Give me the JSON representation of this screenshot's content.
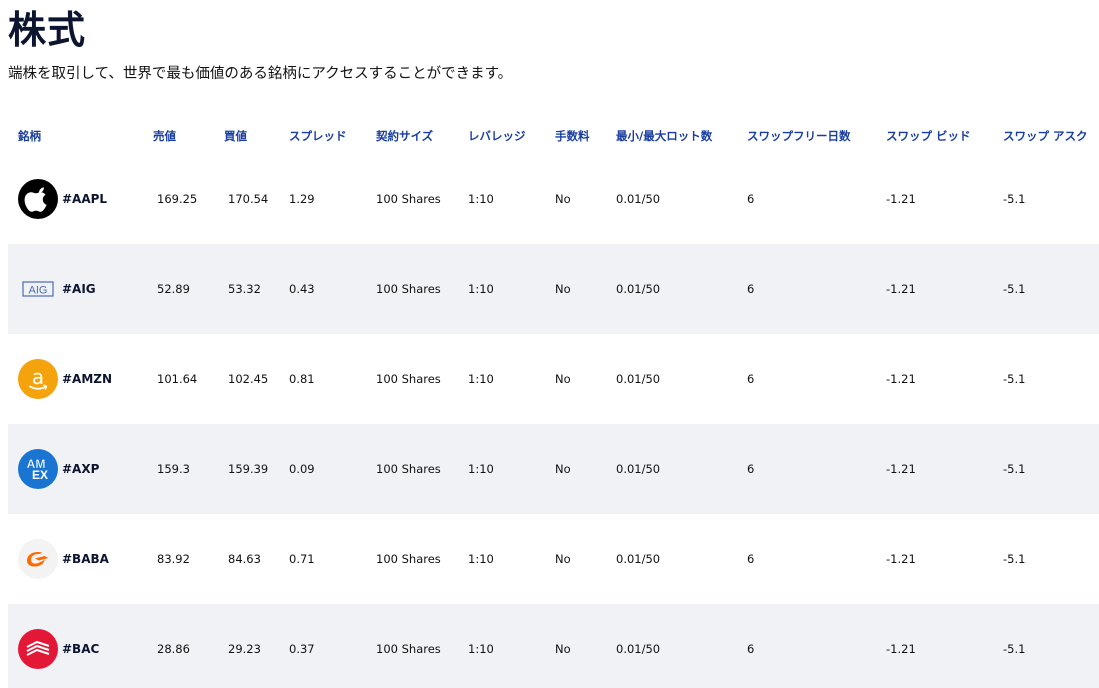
{
  "page": {
    "title": "株式",
    "subtitle": "端株を取引して、世界で最も価値のある銘柄にアクセスすることができます。"
  },
  "table": {
    "headers": {
      "symbol": "銘柄",
      "sell": "売値",
      "buy": "買値",
      "spread": "スプレッド",
      "contract_size": "契約サイズ",
      "leverage": "レバレッジ",
      "commission": "手数料",
      "lot": "最小/最大ロット数",
      "swap_free_days": "スワップフリー日数",
      "swap_bid": "スワップ ビッド",
      "swap_ask": "スワップ アスク"
    },
    "rows": [
      {
        "logo_icon": "apple-logo-icon",
        "symbol": "#AAPL",
        "sell": "169.25",
        "buy": "170.54",
        "spread": "1.29",
        "contract_size": "100 Shares",
        "leverage": "1:10",
        "commission": "No",
        "lot": "0.01/50",
        "swap_free_days": "6",
        "swap_bid": "-1.21",
        "swap_ask": "-5.1"
      },
      {
        "logo_icon": "aig-logo-icon",
        "logo_text": "AIG",
        "symbol": "#AIG",
        "sell": "52.89",
        "buy": "53.32",
        "spread": "0.43",
        "contract_size": "100 Shares",
        "leverage": "1:10",
        "commission": "No",
        "lot": "0.01/50",
        "swap_free_days": "6",
        "swap_bid": "-1.21",
        "swap_ask": "-5.1"
      },
      {
        "logo_icon": "amazon-logo-icon",
        "logo_text": "a",
        "symbol": "#AMZN",
        "sell": "101.64",
        "buy": "102.45",
        "spread": "0.81",
        "contract_size": "100 Shares",
        "leverage": "1:10",
        "commission": "No",
        "lot": "0.01/50",
        "swap_free_days": "6",
        "swap_bid": "-1.21",
        "swap_ask": "-5.1"
      },
      {
        "logo_icon": "amex-logo-icon",
        "logo_text_top": "AM",
        "logo_text_bottom": "EX",
        "symbol": "#AXP",
        "sell": "159.3",
        "buy": "159.39",
        "spread": "0.09",
        "contract_size": "100 Shares",
        "leverage": "1:10",
        "commission": "No",
        "lot": "0.01/50",
        "swap_free_days": "6",
        "swap_bid": "-1.21",
        "swap_ask": "-5.1"
      },
      {
        "logo_icon": "alibaba-logo-icon",
        "symbol": "#BABA",
        "sell": "83.92",
        "buy": "84.63",
        "spread": "0.71",
        "contract_size": "100 Shares",
        "leverage": "1:10",
        "commission": "No",
        "lot": "0.01/50",
        "swap_free_days": "6",
        "swap_bid": "-1.21",
        "swap_ask": "-5.1"
      },
      {
        "logo_icon": "bank-of-america-logo-icon",
        "symbol": "#BAC",
        "sell": "28.86",
        "buy": "29.23",
        "spread": "0.37",
        "contract_size": "100 Shares",
        "leverage": "1:10",
        "commission": "No",
        "lot": "0.01/50",
        "swap_free_days": "6",
        "swap_bid": "-1.21",
        "swap_ask": "-5.1"
      }
    ]
  },
  "colors": {
    "title": "#0d1430",
    "header_text": "#1a3ea0",
    "row_alt_bg": "#f1f2f5",
    "apple_bg": "#000000",
    "aig_blue": "#4a6db5",
    "amazon_orange": "#f5a30c",
    "amex_blue": "#1a74d2",
    "alibaba_orange": "#ff6a00",
    "boa_red": "#e31837"
  }
}
